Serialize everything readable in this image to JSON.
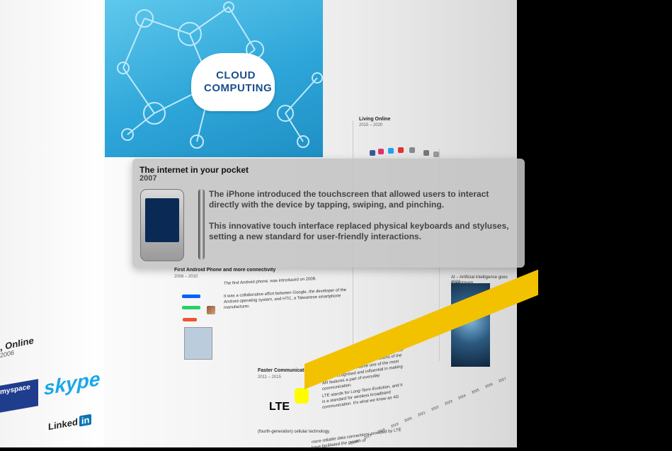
{
  "tooltip": {
    "title": "The internet in your pocket",
    "year": "2007",
    "paragraph1": "The iPhone introduced the touchscreen that allowed users to interact directly with the device by tapping, swiping, and pinching.",
    "paragraph2": "This innovative touch interface replaced physical keyboards and styluses, setting a new standard for user-friendly interactions."
  },
  "cloud_image": {
    "title": "CLOUD COMPUTING"
  },
  "living_online": {
    "title": "Living Online",
    "years": "2015 – 2020"
  },
  "android": {
    "title": "First Android Phone and more connectivity",
    "years": "2008 – 2010",
    "text1": "The first Android phone, was introduced on 2008.",
    "text2": "It was a collaborative effort between Google, the developer of the Android operating system, and HTC, a Taiwanese smartphone manufacturer."
  },
  "faster_comm": {
    "title": "Faster Communication – 4G",
    "years": "2011 – 2015",
    "text1": "Snapchat might not have been the first app to use AR, but with the introductions of the filters in 2015, it became one of the most widely recognised and influential in making AR features a part of everyday communication.",
    "text2": "LTE stands for Long-Term Evolution, and it is a standard for wireless broadband communication. It's what we know as 4G",
    "text3": "(fourth-generation) cellular technology.",
    "text4": "more reliable data connections provided by LTE have facilitated the growth of",
    "lte_label": "LTE"
  },
  "ai": {
    "title": "AI – Artificial Intelligence goes mainstream",
    "year": "2022"
  },
  "left_section": {
    "title": ", Online",
    "years": "2006",
    "skype": "skype",
    "myspace": "myspace",
    "linkedin": "Linked",
    "linkedin_in": "in"
  },
  "timeline_years": [
    "2016",
    "2017",
    "2018",
    "2019",
    "2020",
    "2021",
    "2022",
    "2023",
    "2024",
    "2025",
    "2026",
    "2027"
  ],
  "colors": {
    "timeline": "#f2c200",
    "cloud": "#2ea6d9",
    "tooltip_bg": "#c4c4c4"
  }
}
